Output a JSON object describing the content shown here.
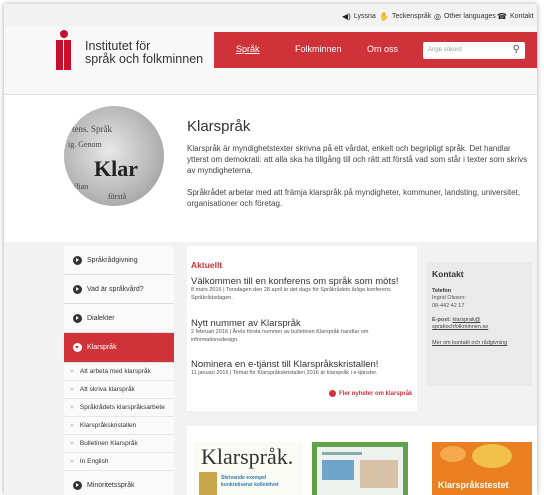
{
  "topbar": {
    "listen": "Lyssna",
    "sign": "Teckenspråk",
    "languages": "Other languages",
    "contact": "Kontakt"
  },
  "logo": {
    "line1": "Institutet för",
    "line2": "språk och folkminnen"
  },
  "nav": {
    "items": [
      "Språk",
      "Folkminnen",
      "Om oss"
    ],
    "search_placeholder": "Ange sökord"
  },
  "intro": {
    "image_words": [
      "tens. Språk",
      "ig. Genom",
      "Klar",
      "ilian",
      "förstå"
    ],
    "title": "Klarspråk",
    "p1": "Klarspråk är myndighetstexter skrivna på ett vårdat, enkelt och begripligt språk. Det handlar ytterst om demokrati: att alla ska ha tillgång till och rätt att förstå vad som står i texter som skrivs av myndigheterna.",
    "p2": "Språkrådet arbetar med att främja klarspråk på myndigheter, kommuner, landsting, universitet, organisationer och företag."
  },
  "sidebar": {
    "top": [
      "Språkrådgivning",
      "Vad är språkvård?",
      "Dialekter"
    ],
    "active": "Klarspråk",
    "sub": [
      "Att arbeta med klarspråk",
      "Att skriva klarspråk",
      "Språkrådets klarspråksarbete",
      "Klarspråkskristallen",
      "Bulletinen Klarspråk",
      "In English"
    ],
    "bottom": "Minoritetsspråk"
  },
  "news": {
    "heading": "Aktuellt",
    "items": [
      {
        "title": "Välkommen till en konferens om språk som möts!",
        "meta": "8 mars 2016  |  Torsdagen den 28 april är det dags för Språkrådets årliga konferens Språkrådsdagen."
      },
      {
        "title": "Nytt nummer av Klarspråk",
        "meta": "2 februari 2016  |  Årets första nummer av bulletinen Klarspråk handlar om informationsdesign."
      },
      {
        "title": "Nominera en e-tjänst till Klarspråkskristallen!",
        "meta": "11 januari 2016  |  Temat för Klarspråkskristallen 2016 är klarspråk i e-tjänster."
      }
    ],
    "more": "Fler nyheter om klarspråk"
  },
  "contact": {
    "title": "Kontakt",
    "phone_label": "Telefon",
    "name": "Ingrid Olsson:",
    "phone": "08-442 42 17",
    "email_label": "E-post:",
    "email1": "klarsprak@",
    "email2": "sprakochfolkminnen.se",
    "more": "Mer om kontakt och rådgivning"
  },
  "thumbs": {
    "t1_title": "Klarspråk.",
    "t1_sub": "Skrivande exempel",
    "t1_sub2": "konkretiserar kollektivet",
    "t3_title": "Klarspråkstestet"
  },
  "colors": {
    "accent": "#cf3339",
    "bg": "#f3f2f2"
  }
}
